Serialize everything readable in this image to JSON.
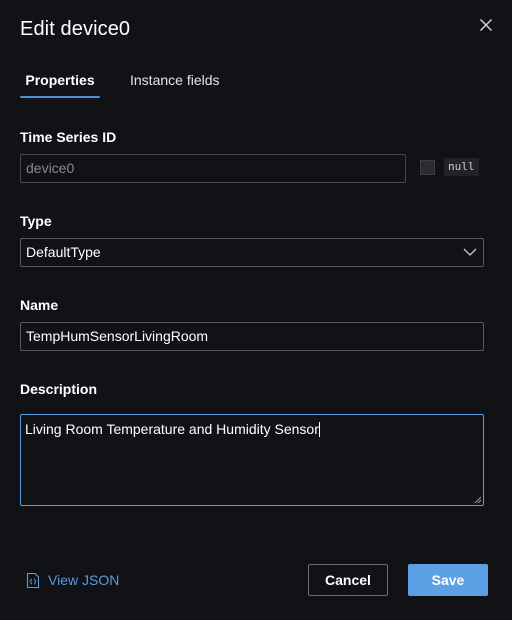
{
  "dialog": {
    "title": "Edit device0"
  },
  "tabs": [
    {
      "label": "Properties",
      "active": true
    },
    {
      "label": "Instance fields",
      "active": false
    }
  ],
  "fields": {
    "time_series_id": {
      "label": "Time Series ID",
      "value": "device0",
      "disabled": true,
      "null_label": "null"
    },
    "type": {
      "label": "Type",
      "value": "DefaultType"
    },
    "name": {
      "label": "Name",
      "value": "TempHumSensorLivingRoom"
    },
    "description": {
      "label": "Description",
      "value": "Living Room Temperature and Humidity Sensor"
    }
  },
  "footer": {
    "view_json_label": "View JSON",
    "cancel_label": "Cancel",
    "save_label": "Save"
  },
  "icons": {
    "close": "close-icon",
    "chevron": "chevron-down-icon",
    "json": "json-file-icon",
    "resize": "resize-grip-icon"
  },
  "colors": {
    "background": "#111216",
    "accent": "#5ea0e6",
    "link": "#5b9be0",
    "border": "#5b5b5f"
  }
}
